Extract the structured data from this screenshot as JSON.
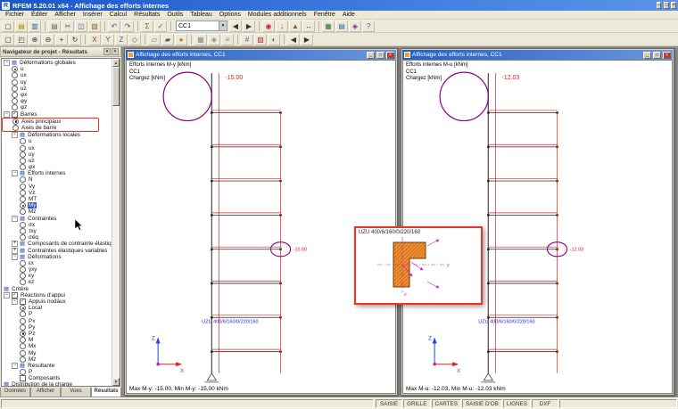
{
  "app": {
    "title": "RFEM 5.20.01 x64 - Affichage des efforts internes",
    "menus": [
      "Fichier",
      "Éditer",
      "Afficher",
      "Insérer",
      "Calcul",
      "Résultats",
      "Outils",
      "Tableau",
      "Options",
      "Modules additionnels",
      "Fenêtre",
      "Aide"
    ],
    "minimize": "–",
    "maximize": "□",
    "close": "×"
  },
  "toolbar1": {
    "combo_value": "CC1",
    "icons": [
      {
        "n": "new",
        "g": "▢",
        "c": "#4a4a4a"
      },
      {
        "n": "open",
        "g": "▤",
        "c": "#b8860b"
      },
      {
        "n": "save",
        "g": "▥",
        "c": "#3a62b0"
      },
      {
        "sep": true
      },
      {
        "n": "print",
        "g": "▤",
        "c": "#666666"
      },
      {
        "n": "cut",
        "g": "✂",
        "c": "#555555"
      },
      {
        "n": "copy",
        "g": "◫",
        "c": "#3a62b0"
      },
      {
        "n": "paste",
        "g": "▧",
        "c": "#8a6a2a"
      },
      {
        "sep": true
      },
      {
        "n": "undo",
        "g": "↶",
        "c": "#3a62b0"
      },
      {
        "n": "redo",
        "g": "↷",
        "c": "#3a62b0"
      },
      {
        "sep": true
      },
      {
        "n": "calculate",
        "g": "Σ",
        "c": "#2e7d32"
      },
      {
        "n": "check",
        "g": "✓",
        "c": "#2e7d32"
      },
      {
        "sep": true
      },
      {
        "combo": true
      },
      {
        "n": "previous-load-case",
        "g": "◀",
        "c": "#333333"
      },
      {
        "n": "next-load-case",
        "g": "▶",
        "c": "#333333"
      },
      {
        "sep": true
      },
      {
        "n": "show-results",
        "g": "◉",
        "c": "#b03030"
      },
      {
        "n": "loads",
        "g": "↓",
        "c": "#c03030"
      },
      {
        "n": "supports",
        "g": "▲",
        "c": "#8a5a2a"
      },
      {
        "n": "dimensions",
        "g": "↔",
        "c": "#3a62b0"
      },
      {
        "sep": true
      },
      {
        "n": "tables",
        "g": "▦",
        "c": "#2e7d32"
      },
      {
        "n": "printout-report",
        "g": "▤",
        "c": "#3a62b0"
      },
      {
        "n": "add-on-modules",
        "g": "◈",
        "c": "#7b1fa2"
      },
      {
        "n": "help",
        "g": "?",
        "c": "#3a62b0"
      }
    ]
  },
  "toolbar2": {
    "icons": [
      {
        "n": "select",
        "g": "▢",
        "c": "#333333"
      },
      {
        "n": "zoom-window",
        "g": "◰",
        "c": "#333333"
      },
      {
        "n": "zoom-in",
        "g": "⊕",
        "c": "#333333"
      },
      {
        "n": "zoom-out",
        "g": "⊖",
        "c": "#333333"
      },
      {
        "n": "pan",
        "g": "+",
        "c": "#333333"
      },
      {
        "n": "rotate-view",
        "g": "↻",
        "c": "#333333"
      },
      {
        "sep": true
      },
      {
        "n": "view-x",
        "g": "X",
        "c": "#b03030"
      },
      {
        "n": "view-y",
        "g": "Y",
        "c": "#2e7d32"
      },
      {
        "n": "view-z",
        "g": "Z",
        "c": "#3a62b0"
      },
      {
        "n": "view-isometric",
        "g": "◇",
        "c": "#555555"
      },
      {
        "sep": true
      },
      {
        "n": "wireframe-model",
        "g": "▱",
        "c": "#555555"
      },
      {
        "n": "solid-model",
        "g": "▰",
        "c": "#555555"
      },
      {
        "n": "rendering",
        "g": "●",
        "c": "#b8860b"
      },
      {
        "sep": true
      },
      {
        "n": "grid",
        "g": "▦",
        "c": "#888888"
      },
      {
        "n": "snap",
        "g": "◈",
        "c": "#888888"
      },
      {
        "n": "guidelines",
        "g": "≡",
        "c": "#888888"
      },
      {
        "sep": true
      },
      {
        "n": "numbering",
        "g": "#",
        "c": "#3a62b0"
      },
      {
        "n": "display-colors",
        "g": "▨",
        "c": "#b03030"
      },
      {
        "n": "visibility",
        "g": "◐",
        "c": "#555555"
      },
      {
        "sep": true
      },
      {
        "n": "previous-view",
        "g": "◀",
        "c": "#333333"
      },
      {
        "n": "next-view",
        "g": "▶",
        "c": "#333333"
      }
    ]
  },
  "navigator": {
    "title": "Navigateur de projet - Résultats",
    "tabs": [
      "Données",
      "Afficher",
      "Vues",
      "Résultats"
    ],
    "active_tab": "Résultats",
    "tree": [
      {
        "l": "Déformations globales",
        "t": "folder",
        "d": 0,
        "e": "-"
      },
      {
        "l": "u",
        "t": "radio-on",
        "d": 1
      },
      {
        "l": "ux",
        "t": "radio-off",
        "d": 1
      },
      {
        "l": "uy",
        "t": "radio-off",
        "d": 1
      },
      {
        "l": "uz",
        "t": "radio-off",
        "d": 1
      },
      {
        "l": "φx",
        "t": "radio-off",
        "d": 1
      },
      {
        "l": "φy",
        "t": "radio-off",
        "d": 1
      },
      {
        "l": "φz",
        "t": "radio-off",
        "d": 1
      },
      {
        "l": "Barres",
        "t": "check-on",
        "d": 0,
        "e": "-"
      },
      {
        "l": "Axes principaux",
        "t": "radio-on",
        "d": 1,
        "hlg": 1
      },
      {
        "l": "Axes de barre",
        "t": "radio-off",
        "d": 1,
        "hlg": 1
      },
      {
        "l": "Déformations locales",
        "t": "folder",
        "d": 1,
        "e": "-"
      },
      {
        "l": "u",
        "t": "radio-off",
        "d": 2
      },
      {
        "l": "ux",
        "t": "radio-off",
        "d": 2
      },
      {
        "l": "uy",
        "t": "radio-off",
        "d": 2
      },
      {
        "l": "uz",
        "t": "radio-off",
        "d": 2
      },
      {
        "l": "φx",
        "t": "radio-off",
        "d": 2
      },
      {
        "l": "Efforts internes",
        "t": "folder",
        "d": 1,
        "e": "-"
      },
      {
        "l": "N",
        "t": "radio-off",
        "d": 2
      },
      {
        "l": "Vy",
        "t": "radio-off",
        "d": 2
      },
      {
        "l": "Vz",
        "t": "radio-off",
        "d": 2
      },
      {
        "l": "MT",
        "t": "radio-off",
        "d": 2
      },
      {
        "l": "My",
        "t": "radio-on",
        "d": 2,
        "sel": 1
      },
      {
        "l": "Mz",
        "t": "radio-off",
        "d": 2
      },
      {
        "l": "Contraintes",
        "t": "folder",
        "d": 1,
        "e": "-"
      },
      {
        "l": "σx",
        "t": "radio-off",
        "d": 2
      },
      {
        "l": "τxy",
        "t": "radio-off",
        "d": 2
      },
      {
        "l": "σéq",
        "t": "radio-off",
        "d": 2
      },
      {
        "l": "Composants de contrainte élastique",
        "t": "folder",
        "d": 1,
        "e": "+"
      },
      {
        "l": "Contraintes élastiques variables",
        "t": "folder",
        "d": 1,
        "e": "+"
      },
      {
        "l": "Déformations",
        "t": "folder",
        "d": 1,
        "e": "-"
      },
      {
        "l": "εx",
        "t": "radio-off",
        "d": 2
      },
      {
        "l": "γxy",
        "t": "radio-off",
        "d": 2
      },
      {
        "l": "κy",
        "t": "radio-off",
        "d": 2
      },
      {
        "l": "κz",
        "t": "radio-off",
        "d": 2
      },
      {
        "l": "Critère",
        "t": "folder",
        "d": 0
      },
      {
        "l": "Réactions d'appui",
        "t": "check-on",
        "d": 0,
        "e": "-"
      },
      {
        "l": "Appuis nodaux",
        "t": "check-on",
        "d": 1,
        "e": "-"
      },
      {
        "l": "Local",
        "t": "radio-on",
        "d": 2
      },
      {
        "l": "P",
        "t": "radio-off",
        "d": 2
      },
      {
        "l": "Px",
        "t": "radio-off",
        "d": 2
      },
      {
        "l": "Py",
        "t": "radio-off",
        "d": 2
      },
      {
        "l": "Pz",
        "t": "radio-on",
        "d": 2
      },
      {
        "l": "M",
        "t": "radio-off",
        "d": 2
      },
      {
        "l": "Mx",
        "t": "radio-off",
        "d": 2
      },
      {
        "l": "My",
        "t": "radio-off",
        "d": 2
      },
      {
        "l": "Mz",
        "t": "radio-off",
        "d": 2
      },
      {
        "l": "Résultante",
        "t": "folder",
        "d": 1,
        "e": "-"
      },
      {
        "l": "P",
        "t": "radio-off",
        "d": 2
      },
      {
        "l": "Composants",
        "t": "check-off",
        "d": 2
      },
      {
        "l": "Distribution de la charge",
        "t": "folder",
        "d": 0
      }
    ]
  },
  "windows": [
    {
      "title": "Affichage des efforts internes, CC1",
      "info_lines": [
        "Efforts internes M-y [kNm]",
        "CC1",
        "Chargez [kNm]"
      ],
      "status": "Max M-y: -15.00, Min M-y: -15.00 kNm",
      "top_value": "-15.00",
      "circle_value": "-15.00",
      "section_label": "UZU 400/6/160/0/220/160",
      "axis_z": "Z",
      "axis_x": "X"
    },
    {
      "title": "Affichage des efforts internes, CC1",
      "info_lines": [
        "Efforts internes M-u [kNm]",
        "CC1",
        "Chargez [kNm]"
      ],
      "status": "Max M-u: -12.03, Min M-u: -12.03 kNm",
      "top_value": "-12.03",
      "circle_value": "-12.03",
      "section_label": "UZU 400/6/160/0/220/160",
      "axis_z": "Z",
      "axis_x": "X"
    }
  ],
  "detail_popup": {
    "title": "UZU 400/6/160/0/220/160",
    "axis_y": "y",
    "axis_z": "z"
  },
  "statusbar": {
    "cells": [
      "SAISIE",
      "GRILLE",
      "CARTES",
      "SAISIE D'OB",
      "LIGNES",
      "DXF"
    ]
  }
}
